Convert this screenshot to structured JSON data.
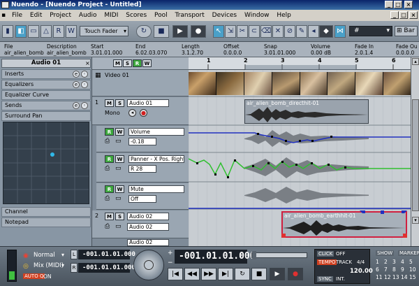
{
  "window": {
    "title": "Nuendo - [Nuendo Project - Untitled]"
  },
  "menu": [
    "File",
    "Edit",
    "Project",
    "Audio",
    "MIDI",
    "Scores",
    "Pool",
    "Transport",
    "Devices",
    "Window",
    "Help"
  ],
  "toolbar": {
    "automation_mode": "Touch Fader",
    "grid": "Bar"
  },
  "infoline": {
    "headers": [
      "File",
      "Description",
      "Start",
      "End",
      "Length",
      "Offset",
      "Snap",
      "Volume",
      "Fade In",
      "Fade Ou"
    ],
    "values": [
      "air_alien_bomb",
      "air_alien_bomb",
      "3.01.01.000",
      "6.02.03.070",
      "3.1.2.70",
      "0.0.0.0",
      "3.01.01.000",
      "0.00 dB",
      "2.0.1.4",
      "0.0.0.0"
    ]
  },
  "inspector": {
    "track_name": "Audio 01",
    "sections": [
      "Inserts",
      "Equalizers",
      "Equalizer Curve",
      "Sends",
      "Surround Pan",
      "Channel",
      "Notepad"
    ]
  },
  "tracks": {
    "video_name": "Video 01",
    "audio1_name": "Audio 01",
    "audio1_mode": "Mono",
    "lane_volume_name": "Volume",
    "lane_volume_value": "-0.18",
    "lane_panner_name": "Panner - X Pos. Right",
    "lane_panner_value": "R 28",
    "lane_mute_name": "Mute",
    "lane_mute_value": "Off",
    "audio2_name": "Audio 02",
    "audio2_sub": "Audio 02",
    "audio3_name": "Audio 02",
    "track_num_1": "1",
    "track_num_2": "2"
  },
  "ruler": {
    "ticks": [
      "1",
      "2",
      "3",
      "4",
      "5",
      "6"
    ]
  },
  "events": {
    "event1": "air_alien_bomb_directhit-01",
    "event2": "air_alien_bomb_earthhit-01"
  },
  "transport": {
    "mode1": "Normal",
    "mode2": "Mix (MIDI)",
    "auto": "AUTO Q",
    "auto_state": "ON",
    "left_locator": "-001.01.01.000",
    "right_locator": "-001.01.01.000",
    "position": "-001.01.01.000",
    "click": "CLICK",
    "click_state": "OFF",
    "tempo": "TEMPO",
    "track": "TRACK",
    "sig": "4/4",
    "bpm": "120.00",
    "sync": "SYNC",
    "sync_state": "INT.",
    "show": "SHOW",
    "markers": "MARKER",
    "marker_nums": [
      "1",
      "2",
      "3",
      "4",
      "5",
      "6",
      "7",
      "8",
      "9",
      "10",
      "11",
      "12",
      "13",
      "14",
      "15"
    ]
  },
  "colors": {
    "accent": "#4aa0c8",
    "waveform": "#2b2b2b",
    "volume_line": "#2030c0",
    "panner_line": "#30c030",
    "selected_event": "#d02040"
  }
}
